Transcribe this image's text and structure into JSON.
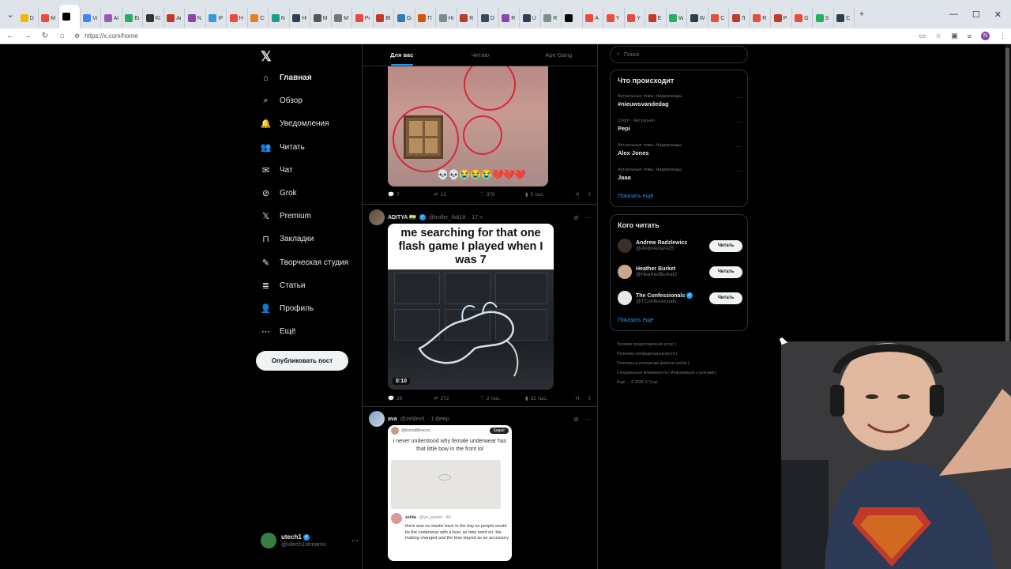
{
  "browser": {
    "url": "https://x.com/home",
    "tabs": [
      "D",
      "M",
      "",
      "Vi",
      "Al",
      "Ei",
      "Kl",
      "Ar",
      "N",
      "IP",
      "H",
      "CI",
      "N",
      "Ht",
      "M",
      "M",
      "Pc",
      "Bt",
      "Gi",
      "Гl",
      "Hi",
      "R",
      "D",
      "R",
      "U",
      "R",
      "",
      "A",
      "Y",
      "Y",
      "E",
      "W",
      "W",
      "C",
      "Л",
      "R",
      "P",
      "G",
      "S",
      "C"
    ],
    "active_tab_index": 2,
    "profile_initial": "N"
  },
  "nav": {
    "items": [
      {
        "label": "Главная",
        "icon": "home-icon",
        "bold": true
      },
      {
        "label": "Обзор",
        "icon": "search-icon"
      },
      {
        "label": "Уведомления",
        "icon": "bell-icon"
      },
      {
        "label": "Читать",
        "icon": "follow-icon"
      },
      {
        "label": "Чат",
        "icon": "mail-icon"
      },
      {
        "label": "Grok",
        "icon": "grok-icon"
      },
      {
        "label": "Premium",
        "icon": "x-icon"
      },
      {
        "label": "Закладки",
        "icon": "bookmark-icon"
      },
      {
        "label": "Творческая студия",
        "icon": "studio-icon"
      },
      {
        "label": "Статьи",
        "icon": "article-icon"
      },
      {
        "label": "Профиль",
        "icon": "person-icon"
      },
      {
        "label": "Ещё",
        "icon": "more-icon"
      }
    ],
    "post_button": "Опубликовать пост",
    "account": {
      "name": "utech1",
      "handle": "@utech1streams"
    }
  },
  "feed": {
    "tabs": [
      "Для вас",
      "Читаю",
      "Ape Gang"
    ],
    "active_tab": 0,
    "post1_stats": {
      "replies": "7",
      "reposts": "12",
      "likes": "370",
      "views": "5 тыс."
    },
    "post2": {
      "name": "ADITYA 🇮🇳",
      "handle": "@troller_Adi18",
      "time": "· 17 ч",
      "caption": "me searching for that one flash game I played when I was 7",
      "duration": "0:10",
      "stats": {
        "replies": "26",
        "reposts": "272",
        "likes": "2 тыс.",
        "views": "32 тыс."
      }
    },
    "post3": {
      "name": "ava",
      "handle": "@zeldevil",
      "time": "· 1 февр.",
      "quoted_top": "i never understood why female underwear has that little bow in the front lol",
      "quoted_handle": "@lismadlbraccio",
      "quoted_follow": "Seguir",
      "reply_name": "zelda",
      "reply_handle": "@yo_pastel · 4h",
      "reply_text": "there was no elastic back in the day so people would tie the underwear with a bow. as time went on, the making changed and the bow stayed as an accessory"
    }
  },
  "sidebar": {
    "search_placeholder": "Поиск",
    "trends_title": "Что происходит",
    "trends": [
      {
        "meta": "Актуальные темы: Нидерланды",
        "title": "#nieuwsvandedag"
      },
      {
        "meta": "Спорт · Актуально",
        "title": "Pepi"
      },
      {
        "meta": "Актуальные темы: Нидерланды",
        "title": "Alex Jones"
      },
      {
        "meta": "Актуальные темы: Нидерланды",
        "title": "Jaaa"
      }
    ],
    "show_more": "Показать ещё",
    "who_title": "Кого читать",
    "who": [
      {
        "name": "Andrew Radzlewicz",
        "handle": "@Andrewraz425",
        "button": "Читать",
        "color": "#3a2f2a"
      },
      {
        "name": "Heather Burket",
        "handle": "@HeatherBurket2",
        "button": "Читать",
        "color": "#c9a789"
      },
      {
        "name": "The Confessionals",
        "handle": "@TConfessionals",
        "button": "Читать",
        "color": "#e8e8e8",
        "verified": true
      }
    ],
    "who_show_more": "Показать ещё",
    "footer": [
      "Условия предоставления услуг",
      "Политика конфиденциальности",
      "Политика в отношении файлов cookie",
      "Специальные возможности",
      "Информация о рекламе",
      "Ещё ···",
      "© 2026 X Corp."
    ]
  },
  "colors": {
    "accent": "#1d9bf0",
    "background": "#000000",
    "border": "#2f3336",
    "muted": "#71767b"
  }
}
